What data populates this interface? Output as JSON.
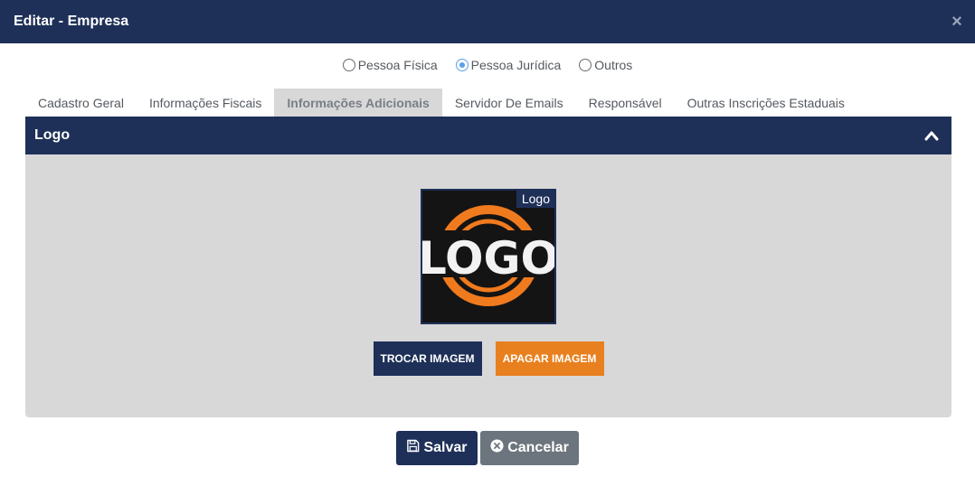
{
  "modal": {
    "title": "Editar - Empresa",
    "close_glyph": "×"
  },
  "person_type": {
    "options": [
      {
        "label": "Pessoa Física",
        "checked": false
      },
      {
        "label": "Pessoa Jurídica",
        "checked": true
      },
      {
        "label": "Outros",
        "checked": false
      }
    ]
  },
  "tabs": [
    {
      "label": "Cadastro Geral",
      "active": false
    },
    {
      "label": "Informações Fiscais",
      "active": false
    },
    {
      "label": "Informações Adicionais",
      "active": true
    },
    {
      "label": "Servidor De Emails",
      "active": false
    },
    {
      "label": "Responsável",
      "active": false
    },
    {
      "label": "Outras Inscrições Estaduais",
      "active": false
    }
  ],
  "panel": {
    "title": "Logo",
    "collapse_icon": "chevron-up-icon",
    "image_tag": "Logo",
    "logo_text": "LOGO",
    "buttons": {
      "change_label": "TROCAR IMAGEM",
      "delete_label": "APAGAR IMAGEM"
    }
  },
  "footer": {
    "save_label": "Salvar",
    "save_icon": "save-icon",
    "cancel_label": "Cancelar",
    "cancel_icon": "cancel-circle-icon"
  },
  "colors": {
    "primary": "#1e3058",
    "accent": "#e8801f",
    "secondary": "#6c757d",
    "panel_bg": "#d8d8d8"
  }
}
